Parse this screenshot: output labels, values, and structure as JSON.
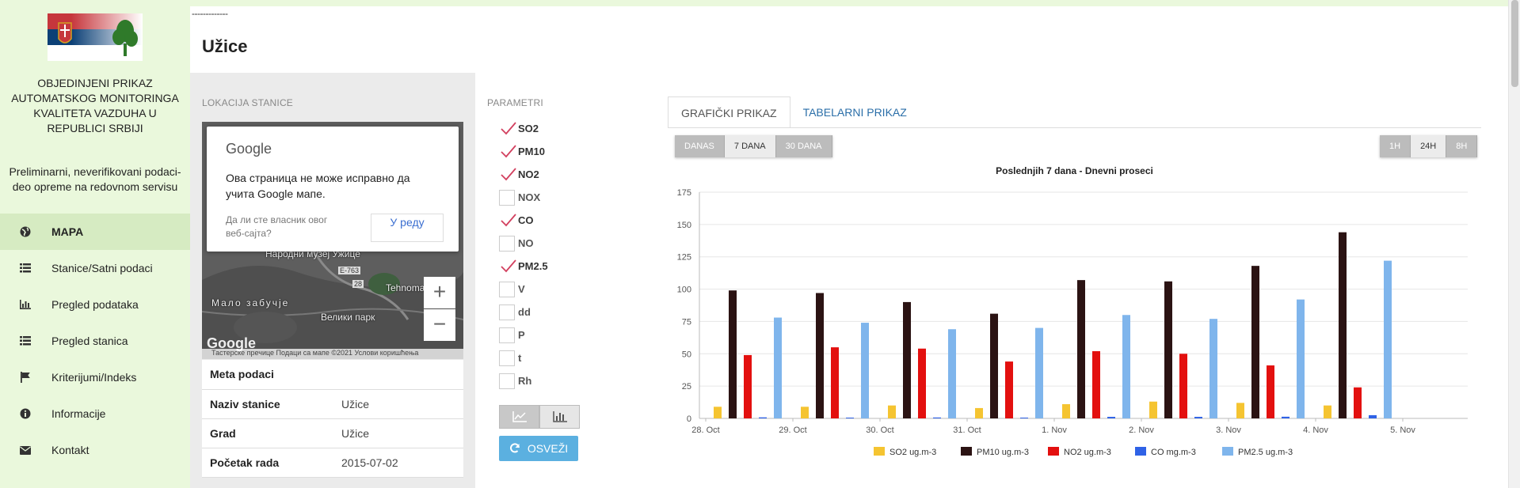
{
  "sidebar": {
    "title": "OBJEDINJENI PRIKAZ AUTOMATSKOG MONITORINGA KVALITETA VAZDUHA U REPUBLICI SRBIJI",
    "note": "Preliminarni, neverifikovani podaci- deo opreme na redovnom servisu",
    "items": [
      {
        "label": "MAPA",
        "icon": "globe-icon",
        "active": true
      },
      {
        "label": "Stanice/Satni podaci",
        "icon": "list-icon",
        "active": false
      },
      {
        "label": "Pregled podataka",
        "icon": "bar-chart-icon",
        "active": false
      },
      {
        "label": "Pregled stanica",
        "icon": "list-icon",
        "active": false
      },
      {
        "label": "Kriterijumi/Indeks",
        "icon": "flag-icon",
        "active": false
      },
      {
        "label": "Informacije",
        "icon": "info-icon",
        "active": false
      },
      {
        "label": "Kontakt",
        "icon": "envelope-icon",
        "active": false
      }
    ]
  },
  "header": {
    "dashes": "-------------",
    "title": "Užice"
  },
  "location": {
    "label": "LOKACIJA STANICE",
    "map": {
      "brand": "Google",
      "error": "Ова страница не може исправно да учита Google мапе.",
      "owner_question": "Да ли сте власник овог веб-сајта?",
      "owner_button": "У реду",
      "labels": [
        "Народни музеј Ужице",
        "Мало забучје",
        "Велики парк",
        "Tehnoma",
        "E-763",
        "28"
      ],
      "footer": "Тастерске пречице   Подаци са мапе ©2021   Услови коришћења",
      "logo": "Google",
      "zoom_in": "+",
      "zoom_out": "−"
    }
  },
  "meta": {
    "header": "Meta podaci",
    "rows": [
      {
        "key": "Naziv stanice",
        "value": "Užice"
      },
      {
        "key": "Grad",
        "value": "Užice"
      },
      {
        "key": "Početak rada",
        "value": "2015-07-02"
      }
    ]
  },
  "parameters": {
    "label": "PARAMETRI",
    "items": [
      {
        "name": "SO2",
        "checked": true
      },
      {
        "name": "PM10",
        "checked": true
      },
      {
        "name": "NO2",
        "checked": true
      },
      {
        "name": "NOX",
        "checked": false
      },
      {
        "name": "CO",
        "checked": true
      },
      {
        "name": "NO",
        "checked": false
      },
      {
        "name": "PM2.5",
        "checked": true
      },
      {
        "name": "V",
        "checked": false
      },
      {
        "name": "dd",
        "checked": false
      },
      {
        "name": "P",
        "checked": false
      },
      {
        "name": "t",
        "checked": false
      },
      {
        "name": "Rh",
        "checked": false
      }
    ],
    "refresh_label": "OSVEŽI"
  },
  "tabs": [
    {
      "label": "GRAFIČKI PRIKAZ",
      "active": true
    },
    {
      "label": "TABELARNI PRIKAZ",
      "active": false
    }
  ],
  "range_buttons": [
    {
      "label": "DANAS",
      "active": false
    },
    {
      "label": "7 DANA",
      "active": true
    },
    {
      "label": "30 DANA",
      "active": false
    }
  ],
  "interval_buttons": [
    {
      "label": "1H",
      "active": false
    },
    {
      "label": "24H",
      "active": true
    },
    {
      "label": "8H",
      "active": false
    }
  ],
  "colors": {
    "SO2": "#f5c431",
    "PM10": "#2b1313",
    "NO2": "#e3100f",
    "CO": "#2f62e6",
    "PM2.5": "#7fb5ec",
    "accent": "#5bb0e0"
  },
  "chart_data": {
    "type": "bar",
    "title": "Poslednjih 7 dana - Dnevni proseci",
    "categories": [
      "28. Oct",
      "29. Oct",
      "30. Oct",
      "31. Oct",
      "1. Nov",
      "2. Nov",
      "3. Nov",
      "4. Nov",
      "5. Nov"
    ],
    "series": [
      {
        "name": "SO2 ug.m-3",
        "values": [
          9,
          9,
          10,
          8,
          11,
          13,
          12,
          10,
          null
        ]
      },
      {
        "name": "PM10 ug.m-3",
        "values": [
          99,
          97,
          90,
          81,
          107,
          106,
          118,
          144,
          null
        ]
      },
      {
        "name": "NO2 ug.m-3",
        "values": [
          49,
          55,
          54,
          44,
          52,
          50,
          41,
          24,
          null
        ]
      },
      {
        "name": "CO mg.m-3",
        "values": [
          0.8,
          0.6,
          0.7,
          0.6,
          1.2,
          1.2,
          1.3,
          2.5,
          null
        ]
      },
      {
        "name": "PM2.5 ug.m-3",
        "values": [
          78,
          74,
          69,
          70,
          80,
          77,
          92,
          122,
          null
        ]
      }
    ],
    "ylim": [
      0,
      175
    ],
    "yticks": [
      0,
      25,
      50,
      75,
      100,
      125,
      150,
      175
    ],
    "grid": true,
    "legend": "bottom"
  }
}
